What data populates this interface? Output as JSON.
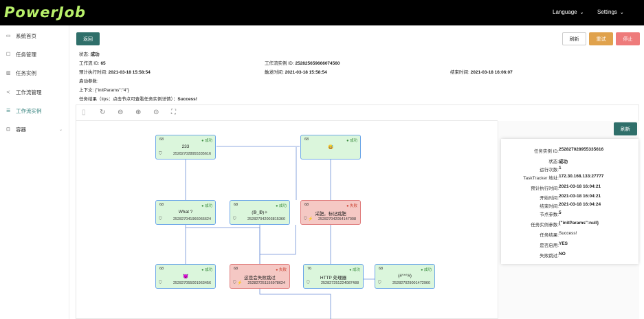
{
  "header": {
    "logo": "PowerJob",
    "language": "Language",
    "settings": "Settings"
  },
  "sidebar": {
    "items": [
      {
        "icon": "monitor-icon",
        "label": "系统首页"
      },
      {
        "icon": "task-icon",
        "label": "任务管理"
      },
      {
        "icon": "bar-chart-icon",
        "label": "任务实例"
      },
      {
        "icon": "share-icon",
        "label": "工作流管理"
      },
      {
        "icon": "list-icon",
        "label": "工作流实例"
      },
      {
        "icon": "container-icon",
        "label": "容器"
      }
    ]
  },
  "toolbar": {
    "back_label": "返回",
    "refresh_label": "刷新",
    "retry_label": "重试",
    "stop_label": "停止"
  },
  "info": {
    "status_k": "状态:",
    "status_v": "成功",
    "wf_id_k": "工作流 ID:",
    "wf_id_v": "65",
    "wf_inst_k": "工作流实例 ID:",
    "wf_inst_v": "252825659666074560",
    "expected_k": "预计执行时间:",
    "expected_v": "2021-03-18 15:58:54",
    "trigger_k": "触发时间:",
    "trigger_v": "2021-03-18 15:58:54",
    "finish_k": "结束时间:",
    "finish_v": "2021-03-18 16:06:07",
    "params_k": "启动参数:",
    "context_k": "上下文:",
    "context_v": "{\"initParams\":\"4\"}",
    "result_k": "任务结果（tips：点击节点可查看任务实例详情）：",
    "result_v": "Success!"
  },
  "graph": {
    "nodes": [
      {
        "id": "68",
        "status": "成功",
        "name": "233",
        "inst": "252827028955335616",
        "fail": false
      },
      {
        "id": "68",
        "status": "成功",
        "name": "😅",
        "inst": "",
        "fail": false
      },
      {
        "id": "68",
        "status": "成功",
        "name": "What ?",
        "inst": "252827041966066624",
        "fail": false
      },
      {
        "id": "68",
        "status": "成功",
        "name": "(ↁ_ↁ)✧",
        "inst": "252827042003815360",
        "fail": false
      },
      {
        "id": "68",
        "status": "失败",
        "name": "采肥，标记跳肥",
        "inst": "252827042054147008",
        "fail": true
      },
      {
        "id": "68",
        "status": "成功",
        "name": "😈",
        "inst": "252827055001963456",
        "fail": false
      },
      {
        "id": "68",
        "status": "失败",
        "name": "这是会失败跳过",
        "inst": "252827251156978624",
        "fail": true
      },
      {
        "id": "76",
        "status": "成功",
        "name": "HTTP 处理器",
        "inst": "252827251224087488",
        "fail": false
      },
      {
        "id": "68",
        "status": "成功",
        "name": "(#°^°#)",
        "inst": "252827029001472960",
        "fail": false
      }
    ]
  },
  "detail": {
    "refresh_label": "刷新",
    "rows": [
      {
        "k": "任务实例 ID:",
        "v": "252827028955335616"
      },
      {
        "k": "状态:",
        "v": "成功"
      },
      {
        "k": "运行次数:",
        "v": "1"
      },
      {
        "k": "TaskTracker 地址:",
        "v": "172.30.168.133:27777"
      },
      {
        "k": "预计执行时间:",
        "v": "2021-03-18 16:04:21"
      },
      {
        "k": "开始时间:",
        "v": "2021-03-18 16:04:21"
      },
      {
        "k": "结束时间:",
        "v": "2021-03-18 16:04:24"
      },
      {
        "k": "节点参数:",
        "v": "5"
      },
      {
        "k": "任务实例参数:",
        "v": "{\"initParams\":null}"
      },
      {
        "k": "任务结果:",
        "v": "Success!"
      },
      {
        "k": "是否启用:",
        "v": "YES"
      },
      {
        "k": "失败跳过:",
        "v": "NO"
      }
    ]
  }
}
